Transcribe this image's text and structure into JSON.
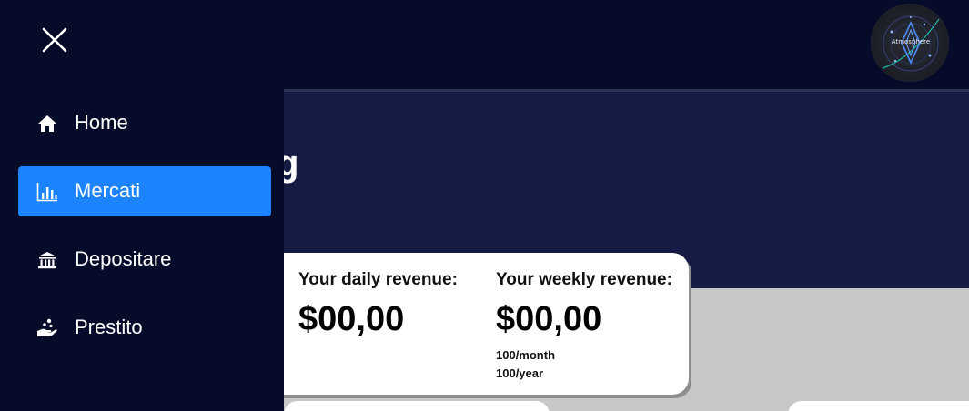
{
  "header": {
    "logo_text": "Atmosphere"
  },
  "sidebar": {
    "items": [
      {
        "label": "Home",
        "icon": "home-icon",
        "active": false
      },
      {
        "label": "Mercati",
        "icon": "bar-chart-icon",
        "active": true
      },
      {
        "label": "Depositare",
        "icon": "bank-icon",
        "active": false
      },
      {
        "label": "Prestito",
        "icon": "loan-hand-icon",
        "active": false
      }
    ]
  },
  "hero": {
    "partial_title": "g"
  },
  "revenue": {
    "daily_label": "Your daily revenue:",
    "daily_value": "$00,00",
    "weekly_label": "Your weekly revenue:",
    "weekly_value": "$00,00",
    "monthly_note": "100/month",
    "yearly_note": "100/year"
  },
  "colors": {
    "sidebar_bg": "#060b29",
    "accent": "#1d84ff",
    "hero_bg": "#151b43",
    "content_bg": "#c8c8c8"
  }
}
